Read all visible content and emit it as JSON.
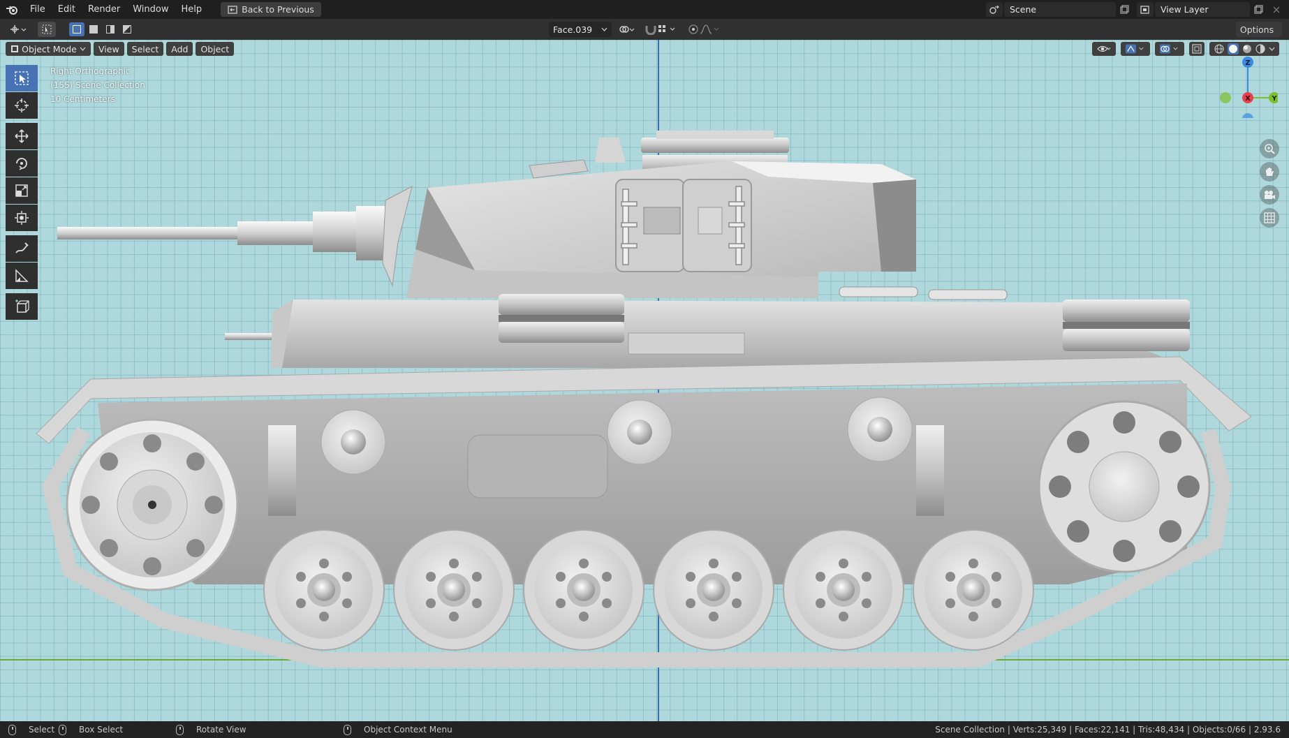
{
  "topbar": {
    "menus": [
      "File",
      "Edit",
      "Render",
      "Window",
      "Help"
    ],
    "back_button": "Back to Previous",
    "scene_label": "Scene",
    "view_layer_label": "View Layer"
  },
  "header": {
    "active_object": "Face.039",
    "options_label": "Options"
  },
  "viewport": {
    "mode": "Object Mode",
    "menus": [
      "View",
      "Select",
      "Add",
      "Object"
    ],
    "overlay": {
      "view_name": "Right Orthographic",
      "collection": "(155) Scene Collection",
      "scale": "10 Centimeters"
    },
    "gizmo": {
      "z": "Z",
      "x": "X",
      "y": "Y"
    }
  },
  "statusbar": {
    "select": "Select",
    "box_select": "Box Select",
    "rotate_view": "Rotate View",
    "context_menu": "Object Context Menu",
    "stats": "Scene Collection | Verts:25,349 | Faces:22,141 | Tris:48,434 | Objects:0/66 | 2.93.6"
  },
  "colors": {
    "viewport_bg": "#aed8dc",
    "accent": "#4772b3",
    "axis_x": "#e8404c",
    "axis_y": "#7ebf2b",
    "axis_z": "#3a8be0"
  }
}
